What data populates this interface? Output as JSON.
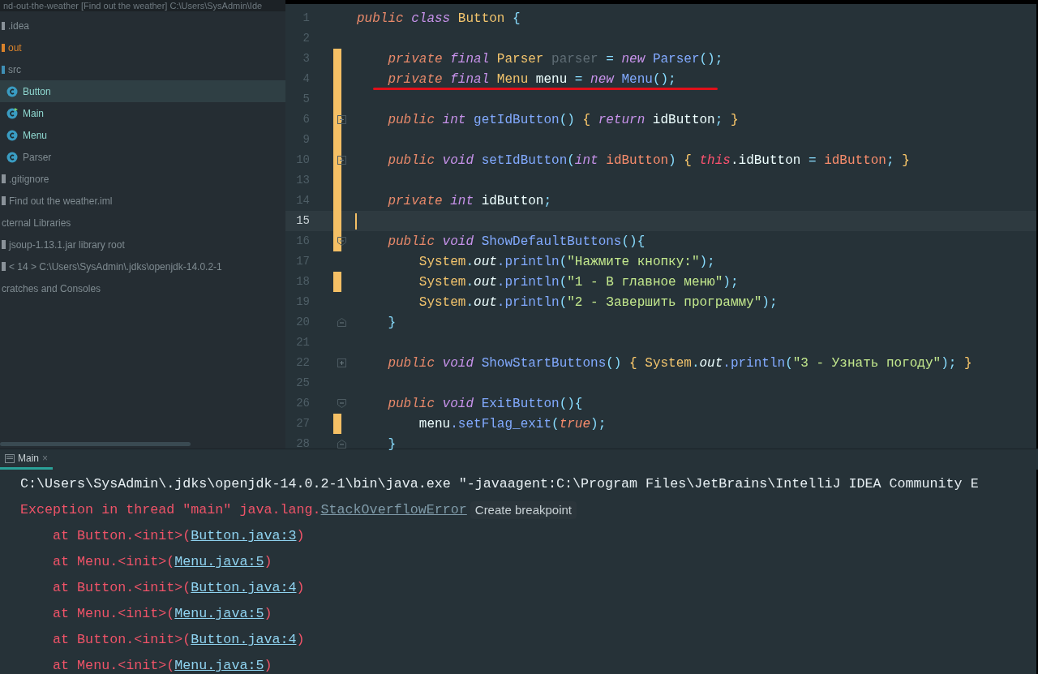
{
  "project_title": "nd-out-the-weather [Find out the weather]  C:\\Users\\SysAdmin\\Ide",
  "tree": [
    {
      "label": ".idea",
      "kind": "folder",
      "color": "#8a9299",
      "excluded": false,
      "modified": false,
      "selected": false
    },
    {
      "label": "out",
      "kind": "folder",
      "color": "#d9822b",
      "excluded": true,
      "modified": false,
      "selected": false
    },
    {
      "label": "src",
      "kind": "folder",
      "color": "#3f8fb5",
      "excluded": false,
      "modified": false,
      "selected": false,
      "children": [
        {
          "label": "Button",
          "kind": "class",
          "excluded": false,
          "modified": true,
          "selected": true
        },
        {
          "label": "Main",
          "kind": "main",
          "excluded": false,
          "modified": true,
          "selected": false
        },
        {
          "label": "Menu",
          "kind": "class",
          "excluded": false,
          "modified": true,
          "selected": false
        },
        {
          "label": "Parser",
          "kind": "class",
          "excluded": false,
          "modified": false,
          "selected": false
        }
      ]
    },
    {
      "label": ".gitignore",
      "kind": "file",
      "excluded": false,
      "modified": false,
      "selected": false
    },
    {
      "label": "Find out the weather.iml",
      "kind": "file",
      "excluded": false,
      "modified": false,
      "selected": false
    },
    {
      "label": "cternal Libraries",
      "kind": "plain",
      "excluded": false,
      "modified": false,
      "selected": false
    },
    {
      "label": "jsoup-1.13.1.jar  library root",
      "kind": "file",
      "excluded": false,
      "modified": false,
      "selected": false
    },
    {
      "label": "< 14 >  C:\\Users\\SysAdmin\\.jdks\\openjdk-14.0.2-1",
      "kind": "file",
      "excluded": false,
      "modified": false,
      "selected": false
    },
    {
      "label": "cratches and Consoles",
      "kind": "plain",
      "excluded": false,
      "modified": false,
      "selected": false
    }
  ],
  "code_lines": [
    {
      "number": "1",
      "changed": false,
      "current": false,
      "underlined": false,
      "tokens": [
        {
          "text": "public",
          "kind": "kw"
        },
        {
          "text": " class",
          "kind": "kw2"
        },
        {
          "text": " Button",
          "kind": "type"
        },
        {
          "text": " {",
          "kind": "punct"
        }
      ]
    },
    {
      "number": "2",
      "changed": false,
      "current": false,
      "underlined": false
    },
    {
      "number": "3",
      "changed": true,
      "current": false,
      "underlined": false,
      "tokens": [
        {
          "text": "    private",
          "kind": "kw"
        },
        {
          "text": " final",
          "kind": "kw2"
        },
        {
          "text": " Parser",
          "kind": "type"
        },
        {
          "text": " parser",
          "kind": "unused"
        },
        {
          "text": " =",
          "kind": "punct"
        },
        {
          "text": " new",
          "kind": "kw2"
        },
        {
          "text": " Parser",
          "kind": "method"
        },
        {
          "text": "();",
          "kind": "punct"
        }
      ]
    },
    {
      "number": "4",
      "changed": true,
      "current": false,
      "underlined": true,
      "tokens": [
        {
          "text": "    private",
          "kind": "kw"
        },
        {
          "text": " final",
          "kind": "kw2"
        },
        {
          "text": " Menu",
          "kind": "type"
        },
        {
          "text": " menu",
          "kind": "plain"
        },
        {
          "text": " =",
          "kind": "punct"
        },
        {
          "text": " new",
          "kind": "kw2"
        },
        {
          "text": " Menu",
          "kind": "method"
        },
        {
          "text": "();",
          "kind": "punct"
        }
      ]
    },
    {
      "number": "5",
      "changed": true,
      "current": false,
      "underlined": false
    },
    {
      "number": "6",
      "changed": true,
      "current": false,
      "underlined": false,
      "fold": {
        "kind": "collapsed"
      },
      "tokens": [
        {
          "text": "    public",
          "kind": "kw"
        },
        {
          "text": " int",
          "kind": "kw2"
        },
        {
          "text": " getIdButton",
          "kind": "method"
        },
        {
          "text": "()",
          "kind": "punct"
        },
        {
          "text": " {",
          "kind": "brace"
        },
        {
          "text": " return",
          "kind": "kw2"
        },
        {
          "text": " idButton",
          "kind": "plain"
        },
        {
          "text": ";",
          "kind": "punct"
        },
        {
          "text": " }",
          "kind": "brace"
        }
      ]
    },
    {
      "number": "9",
      "changed": true,
      "current": false,
      "underlined": false
    },
    {
      "number": "10",
      "changed": true,
      "current": false,
      "underlined": false,
      "fold": {
        "kind": "collapsed"
      },
      "tokens": [
        {
          "text": "    public",
          "kind": "kw"
        },
        {
          "text": " void",
          "kind": "kw2"
        },
        {
          "text": " setIdButton",
          "kind": "method"
        },
        {
          "text": "(",
          "kind": "punct"
        },
        {
          "text": "int",
          "kind": "kw2"
        },
        {
          "text": " idButton",
          "kind": "param"
        },
        {
          "text": ")",
          "kind": "punct"
        },
        {
          "text": " {",
          "kind": "brace"
        },
        {
          "text": " this",
          "kind": "this"
        },
        {
          "text": ".idButton",
          "kind": "plain"
        },
        {
          "text": " =",
          "kind": "punct"
        },
        {
          "text": " idButton",
          "kind": "param"
        },
        {
          "text": ";",
          "kind": "punct"
        },
        {
          "text": " }",
          "kind": "brace"
        }
      ]
    },
    {
      "number": "13",
      "changed": true,
      "current": false,
      "underlined": false
    },
    {
      "number": "14",
      "changed": true,
      "current": false,
      "underlined": false,
      "tokens": [
        {
          "text": "    private",
          "kind": "kw"
        },
        {
          "text": " int",
          "kind": "kw2"
        },
        {
          "text": " idButton",
          "kind": "plain"
        },
        {
          "text": ";",
          "kind": "punct"
        }
      ]
    },
    {
      "number": "15",
      "changed": true,
      "current": true,
      "underlined": false
    },
    {
      "number": "16",
      "changed": true,
      "current": false,
      "underlined": false,
      "fold": {
        "kind": "start"
      },
      "tokens": [
        {
          "text": "    public",
          "kind": "kw"
        },
        {
          "text": " void",
          "kind": "kw2"
        },
        {
          "text": " ShowDefaultButtons",
          "kind": "method"
        },
        {
          "text": "(){",
          "kind": "punct"
        }
      ]
    },
    {
      "number": "17",
      "changed": false,
      "current": false,
      "underlined": false,
      "tokens": [
        {
          "text": "        System",
          "kind": "type"
        },
        {
          "text": ".",
          "kind": "punct"
        },
        {
          "text": "out",
          "kind": "static"
        },
        {
          "text": ".println",
          "kind": "method"
        },
        {
          "text": "(",
          "kind": "punct"
        },
        {
          "text": "\"Нажмите кнопку:\"",
          "kind": "string"
        },
        {
          "text": ");",
          "kind": "punct"
        }
      ]
    },
    {
      "number": "18",
      "changed": true,
      "current": false,
      "underlined": false,
      "tokens": [
        {
          "text": "        System",
          "kind": "type"
        },
        {
          "text": ".",
          "kind": "punct"
        },
        {
          "text": "out",
          "kind": "static"
        },
        {
          "text": ".println",
          "kind": "method"
        },
        {
          "text": "(",
          "kind": "punct"
        },
        {
          "text": "\"1 - В главное меню\"",
          "kind": "string"
        },
        {
          "text": ");",
          "kind": "punct"
        }
      ]
    },
    {
      "number": "19",
      "changed": false,
      "current": false,
      "underlined": false,
      "tokens": [
        {
          "text": "        System",
          "kind": "type"
        },
        {
          "text": ".",
          "kind": "punct"
        },
        {
          "text": "out",
          "kind": "static"
        },
        {
          "text": ".println",
          "kind": "method"
        },
        {
          "text": "(",
          "kind": "punct"
        },
        {
          "text": "\"2 - Завершить программу\"",
          "kind": "string"
        },
        {
          "text": ");",
          "kind": "punct"
        }
      ]
    },
    {
      "number": "20",
      "changed": false,
      "current": false,
      "underlined": false,
      "fold": {
        "kind": "end"
      },
      "tokens": [
        {
          "text": "    }",
          "kind": "punct"
        }
      ]
    },
    {
      "number": "21",
      "changed": false,
      "current": false,
      "underlined": false
    },
    {
      "number": "22",
      "changed": false,
      "current": false,
      "underlined": false,
      "fold": {
        "kind": "collapsed"
      },
      "tokens": [
        {
          "text": "    public",
          "kind": "kw"
        },
        {
          "text": " void",
          "kind": "kw2"
        },
        {
          "text": " ShowStartButtons",
          "kind": "method"
        },
        {
          "text": "()",
          "kind": "punct"
        },
        {
          "text": " {",
          "kind": "brace"
        },
        {
          "text": " System",
          "kind": "type"
        },
        {
          "text": ".",
          "kind": "punct"
        },
        {
          "text": "out",
          "kind": "static"
        },
        {
          "text": ".println",
          "kind": "method"
        },
        {
          "text": "(",
          "kind": "punct"
        },
        {
          "text": "\"3 - Узнать погоду\"",
          "kind": "string"
        },
        {
          "text": ");",
          "kind": "punct"
        },
        {
          "text": " }",
          "kind": "brace"
        }
      ]
    },
    {
      "number": "25",
      "changed": false,
      "current": false,
      "underlined": false
    },
    {
      "number": "26",
      "changed": false,
      "current": false,
      "underlined": false,
      "fold": {
        "kind": "start"
      },
      "tokens": [
        {
          "text": "    public",
          "kind": "kw"
        },
        {
          "text": " void",
          "kind": "kw2"
        },
        {
          "text": " ExitButton",
          "kind": "method"
        },
        {
          "text": "(){",
          "kind": "punct"
        }
      ]
    },
    {
      "number": "27",
      "changed": true,
      "current": false,
      "underlined": false,
      "tokens": [
        {
          "text": "        menu",
          "kind": "plain"
        },
        {
          "text": ".setFlag_exit",
          "kind": "method"
        },
        {
          "text": "(",
          "kind": "punct"
        },
        {
          "text": "true",
          "kind": "bool"
        },
        {
          "text": ");",
          "kind": "punct"
        }
      ]
    },
    {
      "number": "28",
      "changed": false,
      "current": false,
      "underlined": false,
      "fold": {
        "kind": "end"
      },
      "tokens": [
        {
          "text": "    }",
          "kind": "punct"
        }
      ]
    }
  ],
  "run_tab": {
    "label": "Main",
    "close": "×",
    "selected": true
  },
  "console": [
    {
      "segments": [
        {
          "text": "C:\\Users\\SysAdmin\\.jdks\\openjdk-14.0.2-1\\bin\\java.exe \"-javaagent:C:\\Program Files\\JetBrains\\IntelliJ IDEA Community E",
          "kind": "out"
        }
      ]
    },
    {
      "hint": "Create breakpoint",
      "segments": [
        {
          "text": "Exception in thread \"main\" java.lang.",
          "kind": "err"
        },
        {
          "text": "StackOverflowError",
          "kind": "errlink"
        }
      ]
    },
    {
      "segments": [
        {
          "text": "    at Button.<init>(",
          "kind": "err"
        },
        {
          "text": "Button.java:3",
          "kind": "link"
        },
        {
          "text": ")",
          "kind": "err"
        }
      ]
    },
    {
      "segments": [
        {
          "text": "    at Menu.<init>(",
          "kind": "err"
        },
        {
          "text": "Menu.java:5",
          "kind": "link"
        },
        {
          "text": ")",
          "kind": "err"
        }
      ]
    },
    {
      "segments": [
        {
          "text": "    at Button.<init>(",
          "kind": "err"
        },
        {
          "text": "Button.java:4",
          "kind": "link"
        },
        {
          "text": ")",
          "kind": "err"
        }
      ]
    },
    {
      "segments": [
        {
          "text": "    at Menu.<init>(",
          "kind": "err"
        },
        {
          "text": "Menu.java:5",
          "kind": "link"
        },
        {
          "text": ")",
          "kind": "err"
        }
      ]
    },
    {
      "segments": [
        {
          "text": "    at Button.<init>(",
          "kind": "err"
        },
        {
          "text": "Button.java:4",
          "kind": "link"
        },
        {
          "text": ")",
          "kind": "err"
        }
      ]
    },
    {
      "segments": [
        {
          "text": "    at Menu.<init>(",
          "kind": "err"
        },
        {
          "text": "Menu.java:5",
          "kind": "link"
        },
        {
          "text": ")",
          "kind": "err"
        }
      ]
    }
  ]
}
